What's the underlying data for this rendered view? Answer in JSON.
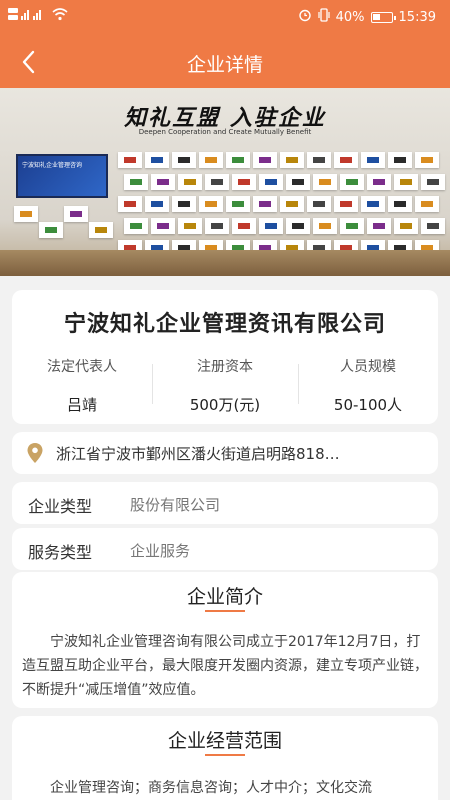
{
  "status_bar": {
    "network_left": "HD 4G 4G",
    "battery": "40%",
    "time": "15:39",
    "battery_level": 0.4
  },
  "header": {
    "title": "企业详情"
  },
  "banner": {
    "slogan": "知礼互盟 入驻企业",
    "subtitle": "Deepen Cooperation and Create Mutually Benefit",
    "screen_text": "宁波知礼企业管理咨询"
  },
  "company": {
    "name": "宁波知礼企业管理资讯有限公司",
    "stats": [
      {
        "label": "法定代表人",
        "value": "吕靖"
      },
      {
        "label": "注册资本",
        "value": "500万(元)"
      },
      {
        "label": "人员规模",
        "value": "50-100人"
      }
    ]
  },
  "address": {
    "text": "浙江省宁波市鄞州区潘火街道启明路818…"
  },
  "info_rows": [
    {
      "label": "企业类型",
      "value": "股份有限公司"
    },
    {
      "label": "服务类型",
      "value": "企业服务"
    }
  ],
  "intro": {
    "title": "企业简介",
    "text": "宁波知礼企业管理咨询有限公司成立于2017年12月7日，打造互盟互助企业平台，最大限度开发圈内资源，建立专项产业链，不断提升“减压增值”效应值。"
  },
  "scope": {
    "title": "企业经营范围",
    "text": "企业管理咨询；商务信息咨询；人才中介；文化交流"
  },
  "colors": {
    "accent": "#ef7a45",
    "background": "#f2f2f2"
  }
}
